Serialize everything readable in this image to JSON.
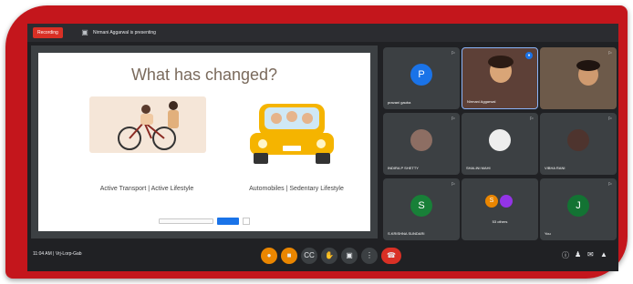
{
  "meeting": {
    "recording_label": "Recording",
    "presenting_text": "Nirmani Aggarwal is presenting",
    "time_code": "11:04 AM  |  Vrj-Lorp-Gab"
  },
  "slide": {
    "title": "What has changed?",
    "left_caption": "Active Transport | Active Lifestyle",
    "right_caption": "Automobiles | Sedentary Lifestyle"
  },
  "tiles": [
    {
      "name": "pravani gauba",
      "initial": "P",
      "color": "#1a73e8"
    },
    {
      "name": "Nirmani Aggarwal",
      "initial": "",
      "color": ""
    },
    {
      "name": "",
      "initial": "",
      "color": ""
    },
    {
      "name": "INDIRA P SHETTY",
      "initial": "",
      "color": ""
    },
    {
      "name": "SHALINI MAHI",
      "initial": "",
      "color": ""
    },
    {
      "name": "VIBHA RANI",
      "initial": "",
      "color": ""
    },
    {
      "name": "S.KRISHNA SUNDARI",
      "initial": "S",
      "color": "#188038"
    },
    {
      "name": "53 others",
      "initial": "S",
      "color": "#ea8600"
    },
    {
      "name": "You",
      "initial": "J",
      "color": "#137333"
    }
  ],
  "controls": {
    "mic_icon": "mic-icon",
    "cam_icon": "cam-icon",
    "cc_icon": "captions-icon",
    "hand_icon": "hand-icon",
    "present_icon": "present-icon",
    "more_icon": "more-icon",
    "end_icon": "end-call-icon"
  },
  "colors": {
    "frame_red": "#c4161c",
    "meet_bg": "#202124",
    "tile_bg": "#3c4043",
    "end_call": "#d93025",
    "accent_blue": "#1a73e8"
  }
}
